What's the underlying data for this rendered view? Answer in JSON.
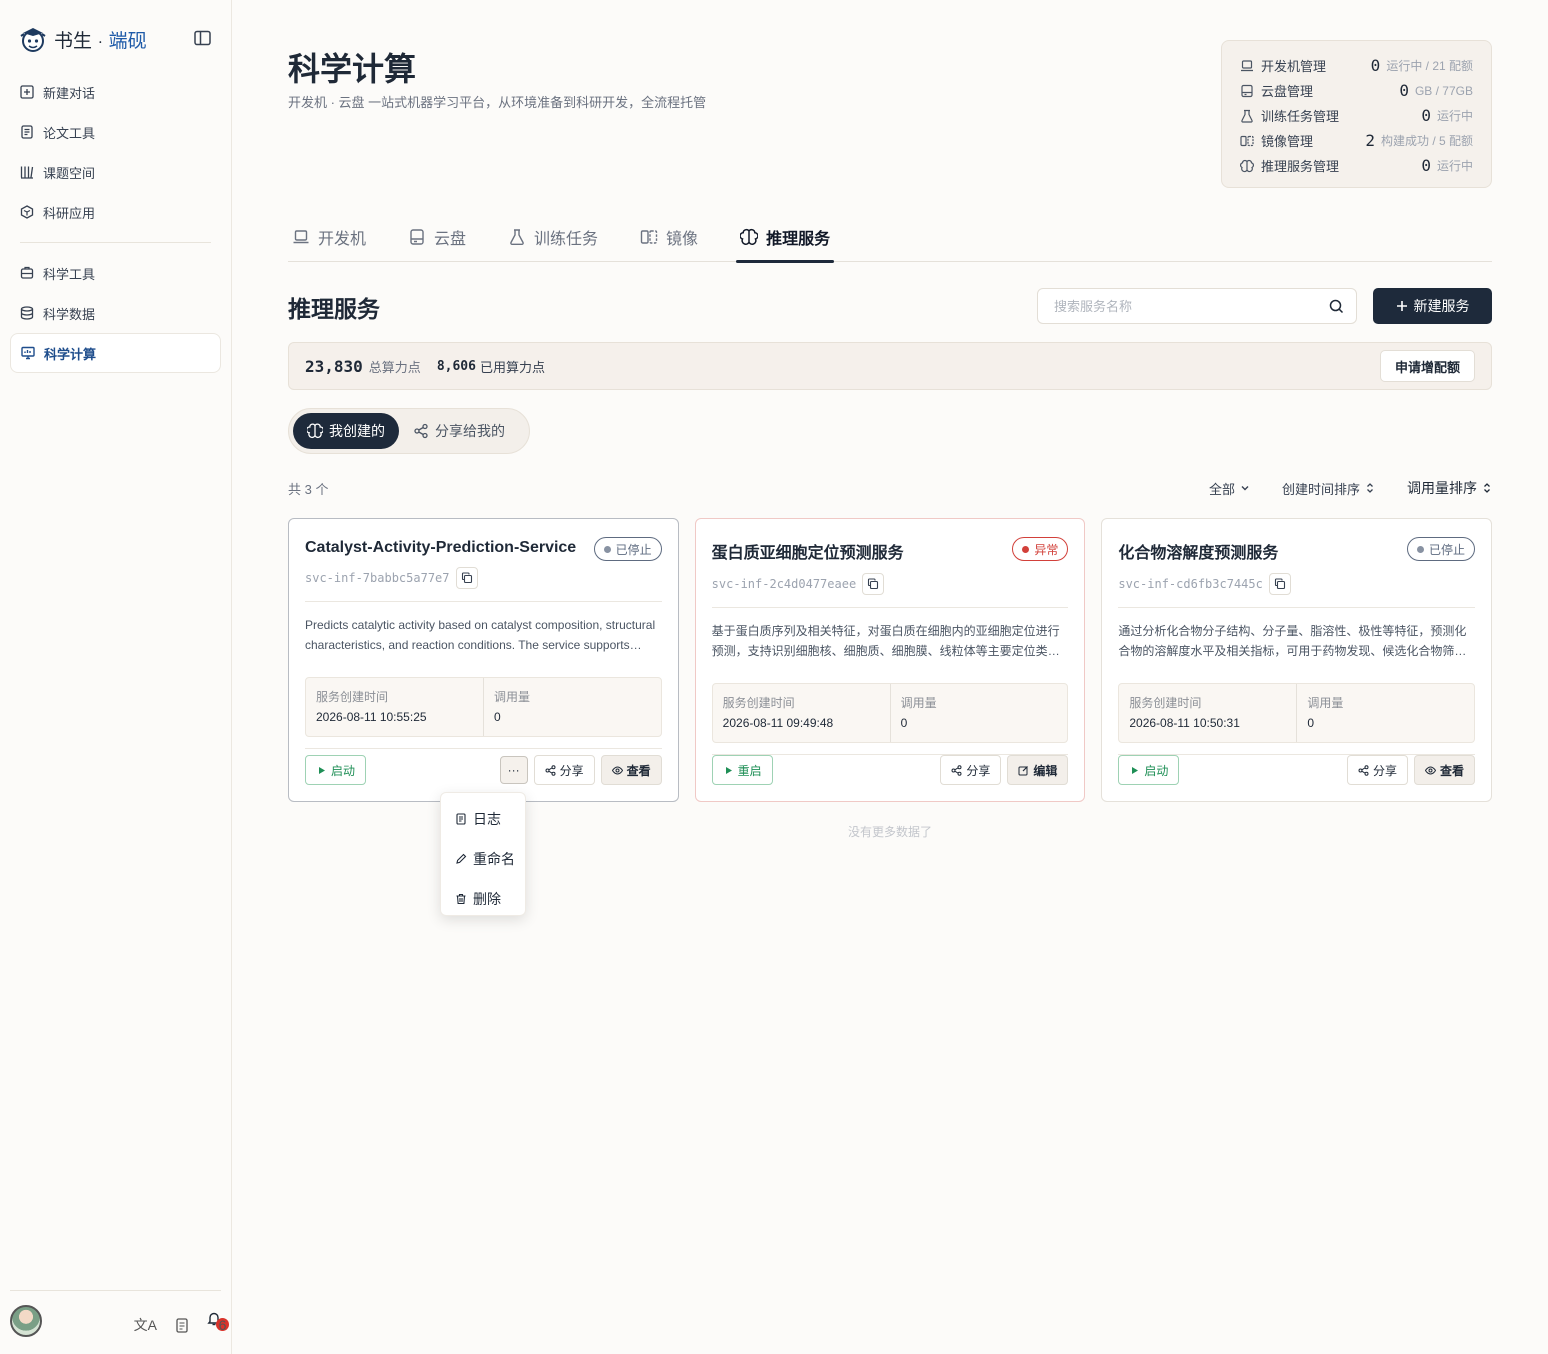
{
  "app": {
    "logo_main": "书生",
    "logo_dot": "·",
    "logo_accent": "端砚"
  },
  "sidebar": {
    "items": [
      {
        "label": "新建对话",
        "icon": "plus-square-icon"
      },
      {
        "label": "论文工具",
        "icon": "document-icon"
      },
      {
        "label": "课题空间",
        "icon": "library-icon"
      },
      {
        "label": "科研应用",
        "icon": "hexagon-icon"
      },
      {
        "label": "科学工具",
        "icon": "toolbox-icon"
      },
      {
        "label": "科学数据",
        "icon": "database-icon"
      },
      {
        "label": "科学计算",
        "icon": "monitor-chart-icon",
        "active": true
      }
    ],
    "notification_count": "6",
    "lang_icon": "文A"
  },
  "header": {
    "title": "科学计算",
    "subtitle": "开发机 · 云盘 一站式机器学习平台，从环境准备到科研开发，全流程托管"
  },
  "stats": [
    {
      "label": "开发机管理",
      "num": "0",
      "unit": "运行中 / 21 配额"
    },
    {
      "label": "云盘管理",
      "num": "0",
      "unit": "GB / 77GB"
    },
    {
      "label": "训练任务管理",
      "num": "0",
      "unit": "运行中"
    },
    {
      "label": "镜像管理",
      "num": "2",
      "unit": "构建成功 / 5 配额"
    },
    {
      "label": "推理服务管理",
      "num": "0",
      "unit": "运行中"
    }
  ],
  "tabs": [
    {
      "label": "开发机"
    },
    {
      "label": "云盘"
    },
    {
      "label": "训练任务"
    },
    {
      "label": "镜像"
    },
    {
      "label": "推理服务",
      "active": true
    }
  ],
  "section": {
    "title": "推理服务",
    "search_placeholder": "搜索服务名称",
    "new_button": "新建服务"
  },
  "quota": {
    "total": "23,830",
    "total_label": "总算力点",
    "used": "8,606",
    "used_label": "已用算力点",
    "apply_button": "申请增配额"
  },
  "segment": {
    "mine": "我创建的",
    "shared": "分享给我的"
  },
  "list": {
    "count": "共 3 个",
    "filter_all": "全部",
    "sort_created": "创建时间排序",
    "sort_calls": "调用量排序",
    "no_more": "没有更多数据了"
  },
  "cards": [
    {
      "name": "Catalyst-Activity-Prediction-Service",
      "status": "已停止",
      "id": "svc-inf-7babbc5a77e7",
      "desc": "Predicts catalytic activity based on catalyst composition, structural characteristics, and reaction conditions. The service supports multiple catalyst types.",
      "created_label": "服务创建时间",
      "created": "2026-08-11 10:55:25",
      "calls_label": "调用量",
      "calls": "0",
      "primary": "启动",
      "more": "···",
      "share": "分享",
      "secondary": "查看"
    },
    {
      "name": "蛋白质亚细胞定位预测服务",
      "status": "异常",
      "id": "svc-inf-2c4d0477eaee",
      "desc": "基于蛋白质序列及相关特征，对蛋白质在细胞内的亚细胞定位进行预测，支持识别细胞核、细胞质、细胞膜、线粒体等主要定位类别。",
      "created_label": "服务创建时间",
      "created": "2026-08-11 09:49:48",
      "calls_label": "调用量",
      "calls": "0",
      "primary": "重启",
      "share": "分享",
      "secondary": "编辑"
    },
    {
      "name": "化合物溶解度预测服务",
      "status": "已停止",
      "id": "svc-inf-cd6fb3c7445c",
      "desc": "通过分析化合物分子结构、分子量、脂溶性、极性等特征，预测化合物的溶解度水平及相关指标，可用于药物发现、候选化合物筛选等场景。",
      "created_label": "服务创建时间",
      "created": "2026-08-11 10:50:31",
      "calls_label": "调用量",
      "calls": "0",
      "primary": "启动",
      "share": "分享",
      "secondary": "查看"
    }
  ],
  "dropdown": {
    "items": [
      "日志",
      "重命名",
      "删除"
    ]
  },
  "colors": {
    "primary_dark": "#1e2a3b",
    "accent_blue": "#1e5aa8",
    "success_green": "#1f8f56",
    "error_red": "#d2403a",
    "background": "#fcfbf9"
  }
}
